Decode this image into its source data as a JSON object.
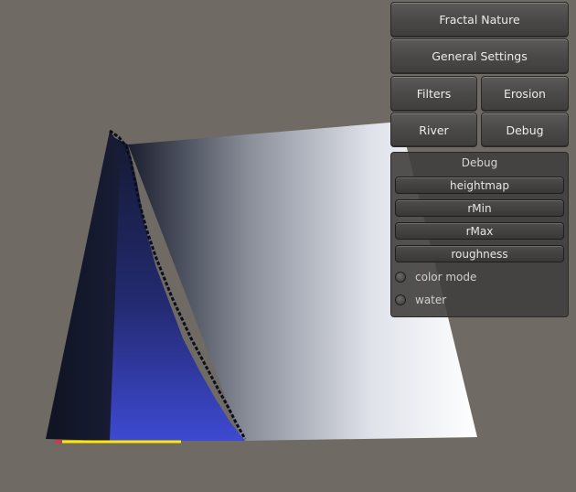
{
  "menu": {
    "fractal_nature": "Fractal Nature",
    "general_settings": "General Settings",
    "filters": "Filters",
    "erosion": "Erosion",
    "river": "River",
    "debug": "Debug"
  },
  "debug_panel": {
    "title": "Debug",
    "buttons": [
      "heightmap",
      "rMin",
      "rMax",
      "roughness"
    ],
    "toggles": [
      {
        "label": "color mode",
        "checked": false
      },
      {
        "label": "water",
        "checked": false
      }
    ]
  },
  "colors": {
    "background": "#6f6a63",
    "terrain_light": "#ffffff",
    "terrain_dark": "#1a1f3a",
    "water_blue": "#3a46c8",
    "edge_yellow": "#ffe800"
  }
}
